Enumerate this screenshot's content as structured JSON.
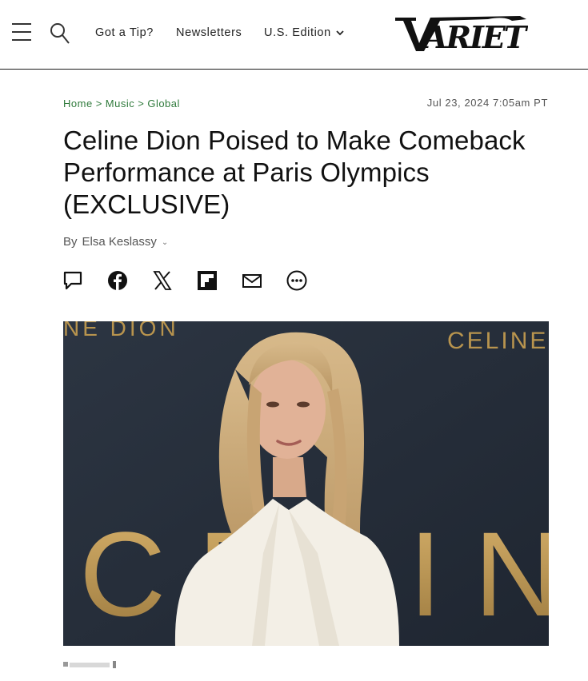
{
  "header": {
    "menu_icon": "hamburger-menu-icon",
    "search_icon": "search-icon",
    "nav": {
      "tip": "Got a Tip?",
      "newsletters": "Newsletters",
      "edition": "U.S. Edition"
    },
    "logo_text": "VARIETY"
  },
  "breadcrumb": {
    "items": [
      "Home",
      "Music",
      "Global"
    ],
    "separator": ">"
  },
  "article": {
    "date": "Jul 23, 2024 7:05am PT",
    "title": "Celine Dion Poised to Make Comeback Performance at Paris Olympics (EXCLUSIVE)",
    "byline_prefix": "By",
    "author": "Elsa Keslassy"
  },
  "share_icons": [
    "comment-icon",
    "facebook-icon",
    "x-icon",
    "flipboard-icon",
    "email-icon",
    "more-icon"
  ],
  "hero": {
    "backdrop_text_top_left": "NE DION",
    "backdrop_text_top_right": "CELINE",
    "backdrop_large_letters": "CELINE"
  },
  "colors": {
    "breadcrumb": "#2f7a3b",
    "backdrop": "#27303d",
    "gold": "#b8944e"
  }
}
